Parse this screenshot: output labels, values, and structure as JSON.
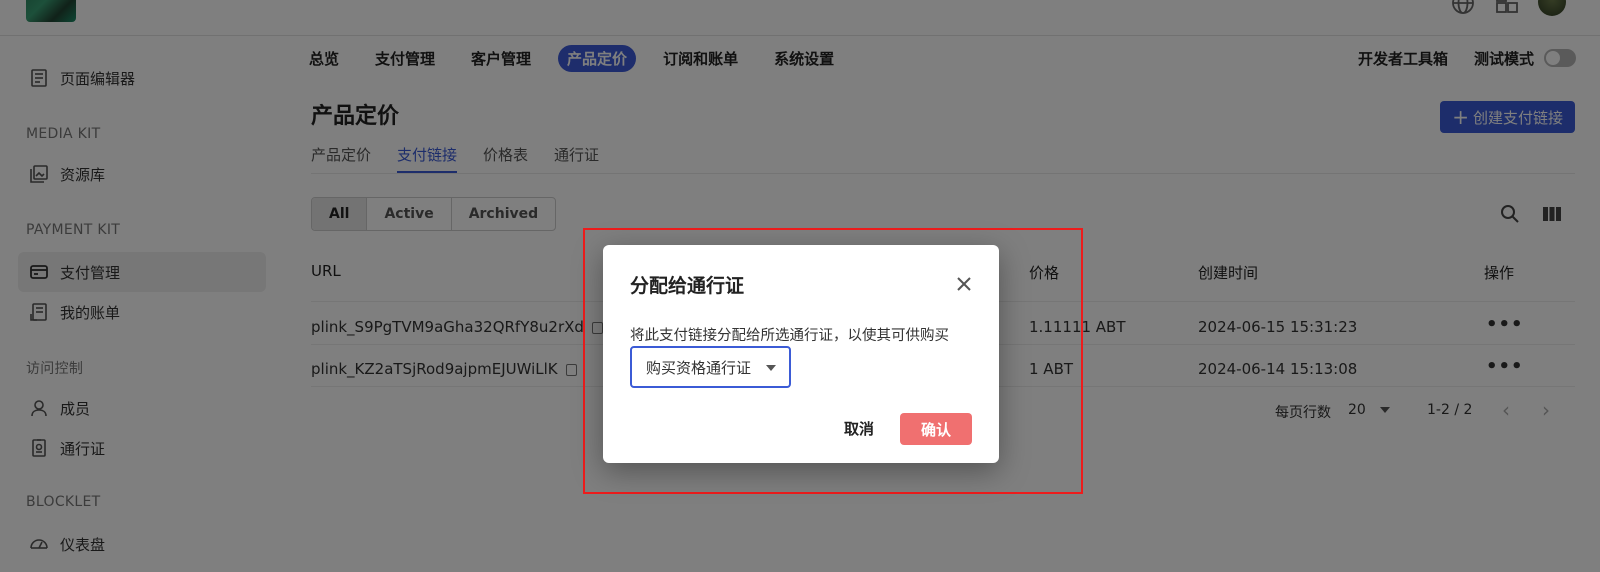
{
  "header": {
    "logo_icon": "app-logo",
    "icons": [
      "globe-icon",
      "grid-icon",
      "avatar"
    ]
  },
  "sidebar": {
    "items": [
      {
        "label": "页面编辑器",
        "icon": "page-editor-icon"
      },
      {
        "label": "资源库",
        "icon": "media-library-icon"
      },
      {
        "label": "支付管理",
        "icon": "payment-card-icon",
        "active": true
      },
      {
        "label": "我的账单",
        "icon": "invoice-icon"
      },
      {
        "label": "成员",
        "icon": "user-icon"
      },
      {
        "label": "通行证",
        "icon": "passport-icon"
      },
      {
        "label": "仪表盘",
        "icon": "dashboard-icon"
      }
    ],
    "sections": {
      "media_kit": "MEDIA KIT",
      "payment_kit": "PAYMENT KIT",
      "access_control": "访问控制",
      "blocklet": "BLOCKLET"
    }
  },
  "nav": {
    "items": [
      "总览",
      "支付管理",
      "客户管理",
      "产品定价",
      "订阅和账单",
      "系统设置"
    ],
    "active_index": 3,
    "developer_tools": "开发者工具箱",
    "test_mode": "测试模式"
  },
  "page": {
    "title": "产品定价",
    "create_button": "创建支付链接",
    "subtabs": [
      "产品定价",
      "支付链接",
      "价格表",
      "通行证"
    ],
    "active_subtab": 1,
    "filters": [
      "All",
      "Active",
      "Archived"
    ],
    "active_filter": 0
  },
  "table": {
    "columns": {
      "url": "URL",
      "price": "价格",
      "created": "创建时间",
      "actions": "操作"
    },
    "rows": [
      {
        "url": "plink_S9PgTVM9aGha32QRfY8u2rXd",
        "price": "1.11111 ABT",
        "created": "2024-06-15 15:31:23",
        "actions": "•••"
      },
      {
        "url": "plink_KZ2aTSjRod9ajpmEJUWiLlK",
        "price": "1 ABT",
        "created": "2024-06-14 15:13:08",
        "actions": "•••"
      }
    ]
  },
  "pagination": {
    "rows_per_page_label": "每页行数",
    "rows_per_page": "20",
    "range": "1-2 / 2"
  },
  "dialog": {
    "title": "分配给通行证",
    "description": "将此支付链接分配给所选通行证，以使其可供购买",
    "select_value": "购买资格通行证",
    "cancel": "取消",
    "confirm": "确认"
  },
  "colors": {
    "accent": "#3b5bd6",
    "confirm": "#f07070",
    "highlight": "#ee1c1c"
  }
}
